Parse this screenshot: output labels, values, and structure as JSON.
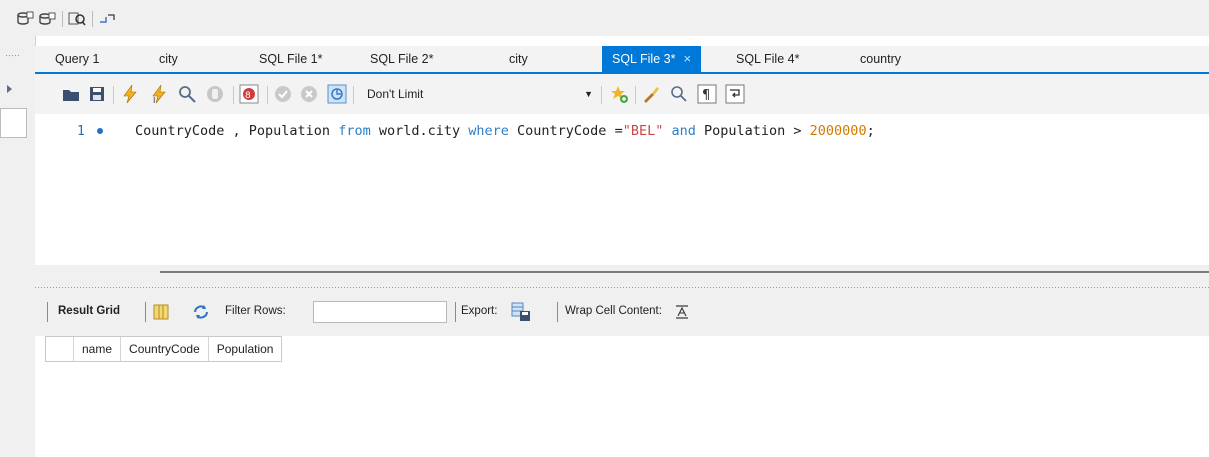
{
  "editor_tabs": [
    {
      "label": "Query 1",
      "active": false
    },
    {
      "label": "city",
      "active": false
    },
    {
      "label": "SQL File 1*",
      "active": false
    },
    {
      "label": "SQL File 2*",
      "active": false
    },
    {
      "label": "city",
      "active": false
    },
    {
      "label": "SQL File 3*",
      "active": true
    },
    {
      "label": "SQL File 4*",
      "active": false
    },
    {
      "label": "country",
      "active": false
    }
  ],
  "tab_close_glyph": "×",
  "toolbar": {
    "limit_value": "Don't Limit"
  },
  "editor": {
    "line_number": "1",
    "code": {
      "part1": "CountryCode , Population ",
      "kw_from": "from",
      "part2": " world.city ",
      "kw_where": "where",
      "part3": " CountryCode =",
      "str_bel": "\"BEL\"",
      "part4": " ",
      "kw_and": "and",
      "part5": " Population > ",
      "num_value": "2000000",
      "part6": ";"
    }
  },
  "result_toolbar": {
    "result_grid_label": "Result Grid",
    "filter_rows_label": "Filter Rows:",
    "filter_value": "",
    "export_label": "Export:",
    "wrap_label": "Wrap Cell Content:"
  },
  "result_grid": {
    "columns": [
      "name",
      "CountryCode",
      "Population"
    ]
  },
  "colors": {
    "accent": "#0078d7",
    "keyword": "#2d7fc7",
    "string": "#c94848",
    "number": "#d17a00"
  }
}
